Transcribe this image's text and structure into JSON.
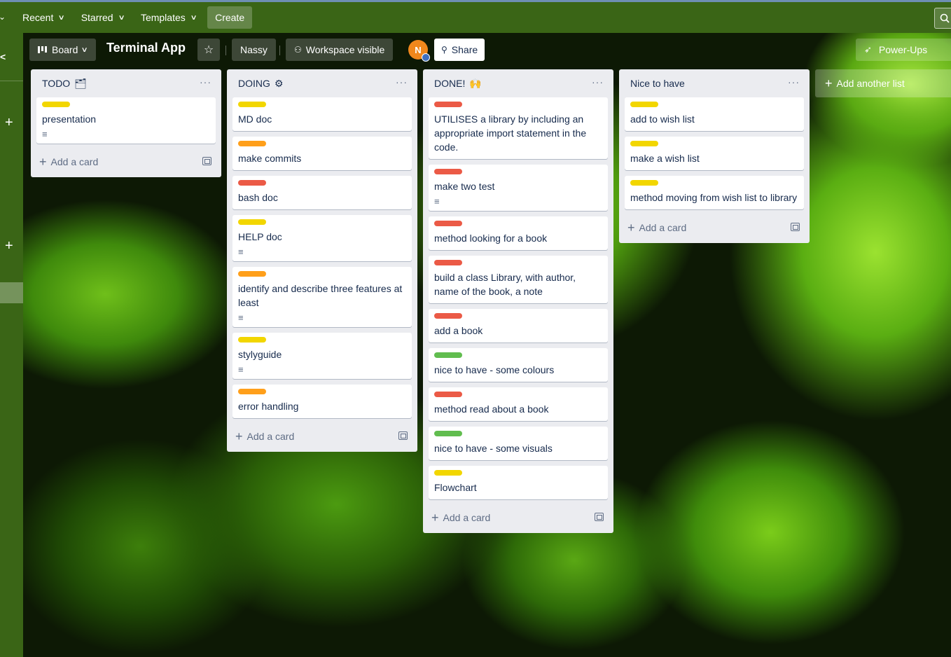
{
  "colors": {
    "topbar": "#3a6516",
    "yellow": "#f2d600",
    "orange": "#ff9f1a",
    "red": "#eb5a46",
    "green": "#61bd4f"
  },
  "topnav": {
    "recent": "Recent",
    "starred": "Starred",
    "templates": "Templates",
    "create": "Create",
    "search_icon": "search-icon"
  },
  "board": {
    "view": "Board",
    "title": "Terminal App",
    "workspace": "Nassy",
    "visibility": "Workspace visible",
    "avatar_initial": "N",
    "share": "Share",
    "powerups": "Power-Ups",
    "add_list": "Add another list"
  },
  "lists": [
    {
      "title": "TODO",
      "emoji": "🗂",
      "cards": [
        {
          "label": "yellow",
          "text": "presentation",
          "desc": true
        }
      ],
      "add": "Add a card"
    },
    {
      "title": "DOING",
      "emoji": "⚙",
      "cards": [
        {
          "label": "yellow",
          "text": "MD doc",
          "desc": false
        },
        {
          "label": "orange",
          "text": "make commits",
          "desc": false
        },
        {
          "label": "red",
          "text": "bash doc",
          "desc": false
        },
        {
          "label": "yellow",
          "text": "HELP doc",
          "desc": true
        },
        {
          "label": "orange",
          "text": "identify and describe three features at least",
          "desc": true
        },
        {
          "label": "yellow",
          "text": "stylyguide",
          "desc": true
        },
        {
          "label": "orange",
          "text": "error handling",
          "desc": false
        }
      ],
      "add": "Add a card"
    },
    {
      "title": "DONE!",
      "emoji": "🙌",
      "cards": [
        {
          "label": "red",
          "text": "UTILISES a library by including an appropriate import statement in the code.",
          "desc": false
        },
        {
          "label": "red",
          "text": "make two test",
          "desc": true
        },
        {
          "label": "red",
          "text": "method looking for a book",
          "desc": false
        },
        {
          "label": "red",
          "text": "build a class Library, with author, name of the book, a note",
          "desc": false
        },
        {
          "label": "red",
          "text": "add a book",
          "desc": false
        },
        {
          "label": "green",
          "text": "nice to have - some colours",
          "desc": false
        },
        {
          "label": "red",
          "text": "method read about a book",
          "desc": false
        },
        {
          "label": "green",
          "text": "nice to have - some visuals",
          "desc": false
        },
        {
          "label": "yellow",
          "text": "Flowchart",
          "desc": false
        }
      ],
      "add": "Add a card"
    },
    {
      "title": "Nice to have",
      "emoji": "",
      "cards": [
        {
          "label": "yellow",
          "text": "add to wish list",
          "desc": false
        },
        {
          "label": "yellow",
          "text": "make a wish list",
          "desc": false
        },
        {
          "label": "yellow",
          "text": "method moving from wish list to library",
          "desc": false
        }
      ],
      "add": "Add a card"
    }
  ]
}
